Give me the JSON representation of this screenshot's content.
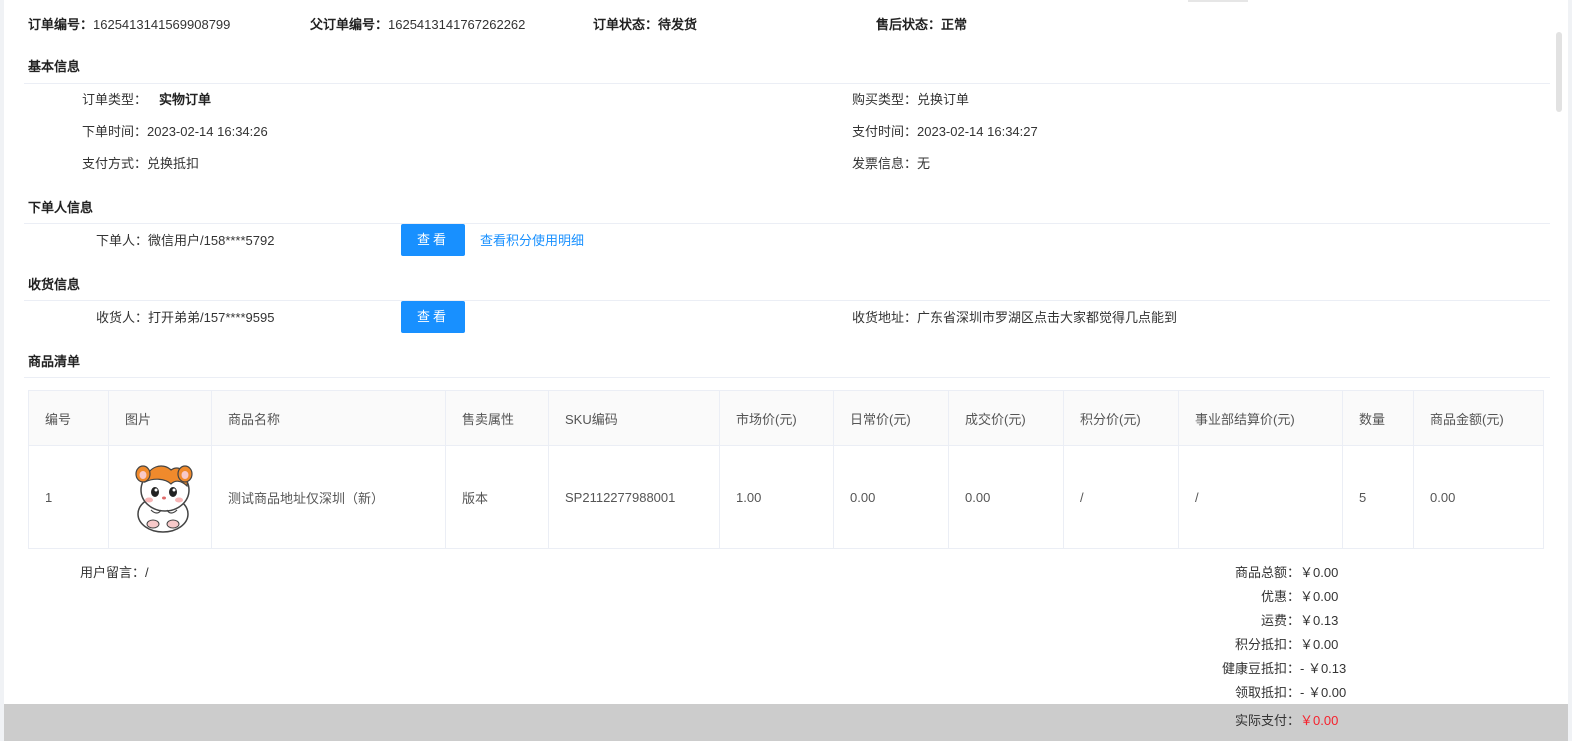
{
  "header": {
    "order_no_label": "订单编号：",
    "order_no": "1625413141569908799",
    "parent_no_label": "父订单编号：",
    "parent_no": "1625413141767262262",
    "status_label": "订单状态：",
    "status": "待发货",
    "aftersale_label": "售后状态：",
    "aftersale": "正常"
  },
  "basic": {
    "title": "基本信息",
    "order_type_label": "订单类型：",
    "order_type": "实物订单",
    "buy_type_label": "购买类型：",
    "buy_type": "兑换订单",
    "order_time_label": "下单时间：",
    "order_time": "2023-02-14 16:34:26",
    "pay_time_label": "支付时间：",
    "pay_time": "2023-02-14 16:34:27",
    "pay_method_label": "支付方式：",
    "pay_method": "兑换抵扣",
    "invoice_label": "发票信息：",
    "invoice": "无"
  },
  "buyer": {
    "title": "下单人信息",
    "label": "下单人：",
    "value": "微信用户/158****5792",
    "view_button": "查看",
    "points_link": "查看积分使用明细"
  },
  "receiver": {
    "title": "收货信息",
    "label": "收货人：",
    "value": "打开弟弟/157****9595",
    "view_button": "查看",
    "address_label": "收货地址：",
    "address": "广东省深圳市罗湖区点击大家都觉得几点能到"
  },
  "goods": {
    "title": "商品清单",
    "columns": [
      "编号",
      "图片",
      "商品名称",
      "售卖属性",
      "SKU编码",
      "市场价(元)",
      "日常价(元)",
      "成交价(元)",
      "积分价(元)",
      "事业部结算价(元)",
      "数量",
      "商品金额(元)"
    ],
    "rows": [
      {
        "no": "1",
        "image_icon": "hamster-product-image",
        "name": "测试商品地址仅深圳（新）",
        "attr": "版本",
        "sku": "SP2112277988001",
        "market_price": "1.00",
        "daily_price": "0.00",
        "deal_price": "0.00",
        "points_price": "/",
        "dept_price": "/",
        "qty": "5",
        "amount": "0.00"
      }
    ]
  },
  "remark": {
    "label": "用户留言：",
    "value": "/"
  },
  "summary": {
    "total_label": "商品总额：",
    "total": "￥0.00",
    "discount_label": "优惠：",
    "discount": "￥0.00",
    "freight_label": "运费：",
    "freight": "￥0.13",
    "points_label": "积分抵扣：",
    "points": "￥0.00",
    "bean_label": "健康豆抵扣：",
    "bean": "- ￥0.13",
    "claim_label": "领取抵扣：",
    "claim": "- ￥0.00",
    "paid_label": "实际支付：",
    "paid": "￥0.00"
  },
  "colors": {
    "primary": "#1890ff",
    "paid_red": "#f5222d",
    "footer_gray": "#cccccc"
  }
}
